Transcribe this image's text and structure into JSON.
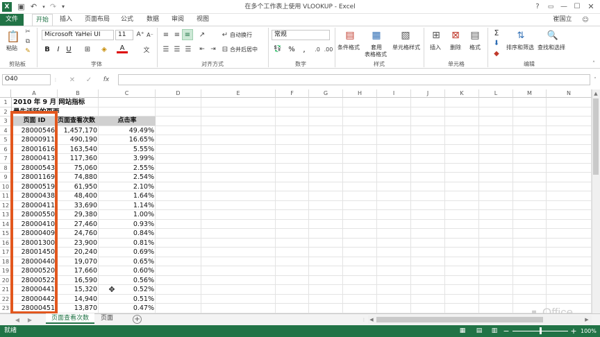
{
  "window": {
    "title": "在多个工作表上使用 VLOOKUP - Excel",
    "user": "崔国立"
  },
  "tabs": [
    {
      "label": "文件"
    },
    {
      "label": "开始"
    },
    {
      "label": "插入"
    },
    {
      "label": "页面布局"
    },
    {
      "label": "公式"
    },
    {
      "label": "数据"
    },
    {
      "label": "审阅"
    },
    {
      "label": "视图"
    }
  ],
  "ribbon": {
    "clipboard": {
      "paste": "粘贴",
      "group": "剪贴板"
    },
    "font": {
      "name": "Microsoft YaHei UI",
      "size": "11",
      "group": "字体"
    },
    "alignment": {
      "wrap": "自动换行",
      "merge": "合并后居中",
      "group": "对齐方式"
    },
    "number": {
      "format": "常规",
      "percent": "%",
      "comma": ",",
      "group": "数字"
    },
    "styles": {
      "cond": "条件格式",
      "table1": "套用",
      "table2": "表格格式",
      "cell": "单元格样式",
      "group": "样式"
    },
    "cells": {
      "insert": "插入",
      "delete": "删除",
      "format": "格式",
      "group": "单元格"
    },
    "editing": {
      "sort": "排序和筛选",
      "find": "查找和选择",
      "group": "编辑"
    }
  },
  "formula_bar": {
    "name_box": "O40",
    "fx": "fx",
    "value": ""
  },
  "columns": [
    "A",
    "B",
    "C",
    "D",
    "E",
    "F",
    "G",
    "H",
    "I",
    "J",
    "K",
    "L",
    "M",
    "N"
  ],
  "rows": [
    "1",
    "2",
    "3",
    "4",
    "5",
    "6",
    "7",
    "8",
    "9",
    "10",
    "11",
    "12",
    "13",
    "14",
    "15",
    "16",
    "17",
    "18",
    "19",
    "20",
    "21",
    "22",
    "23"
  ],
  "sheet": {
    "title": "2010 年 9 月 网站指标",
    "subtitle": "最先活跃的页面",
    "headers": {
      "a": "页面 ID",
      "b": "页面查看次数",
      "c": "点击率"
    },
    "records": [
      {
        "id": "28000546",
        "views": "1,457,170",
        "ctr": "49.49%"
      },
      {
        "id": "28000911",
        "views": "490,190",
        "ctr": "16.65%"
      },
      {
        "id": "28001616",
        "views": "163,540",
        "ctr": "5.55%"
      },
      {
        "id": "28000413",
        "views": "117,360",
        "ctr": "3.99%"
      },
      {
        "id": "28000543",
        "views": "75,060",
        "ctr": "2.55%"
      },
      {
        "id": "28001169",
        "views": "74,880",
        "ctr": "2.54%"
      },
      {
        "id": "28000519",
        "views": "61,950",
        "ctr": "2.10%"
      },
      {
        "id": "28000438",
        "views": "48,400",
        "ctr": "1.64%"
      },
      {
        "id": "28000411",
        "views": "33,690",
        "ctr": "1.14%"
      },
      {
        "id": "28000550",
        "views": "29,380",
        "ctr": "1.00%"
      },
      {
        "id": "28000410",
        "views": "27,460",
        "ctr": "0.93%"
      },
      {
        "id": "28000409",
        "views": "24,760",
        "ctr": "0.84%"
      },
      {
        "id": "28001300",
        "views": "23,900",
        "ctr": "0.81%"
      },
      {
        "id": "28001450",
        "views": "20,240",
        "ctr": "0.69%"
      },
      {
        "id": "28000440",
        "views": "19,070",
        "ctr": "0.65%"
      },
      {
        "id": "28000520",
        "views": "17,660",
        "ctr": "0.60%"
      },
      {
        "id": "28000522",
        "views": "16,590",
        "ctr": "0.56%"
      },
      {
        "id": "28000441",
        "views": "15,320",
        "ctr": "0.52%"
      },
      {
        "id": "28000442",
        "views": "14,940",
        "ctr": "0.51%"
      },
      {
        "id": "28000451",
        "views": "13,870",
        "ctr": "0.47%"
      }
    ]
  },
  "sheet_tabs": [
    {
      "label": "页面查看次数"
    },
    {
      "label": "页面"
    }
  ],
  "status": {
    "ready": "就绪",
    "zoom": "100%"
  },
  "watermark": {
    "text": "Office"
  },
  "colors": {
    "accent": "#217346",
    "highlight": "#e2571e"
  }
}
